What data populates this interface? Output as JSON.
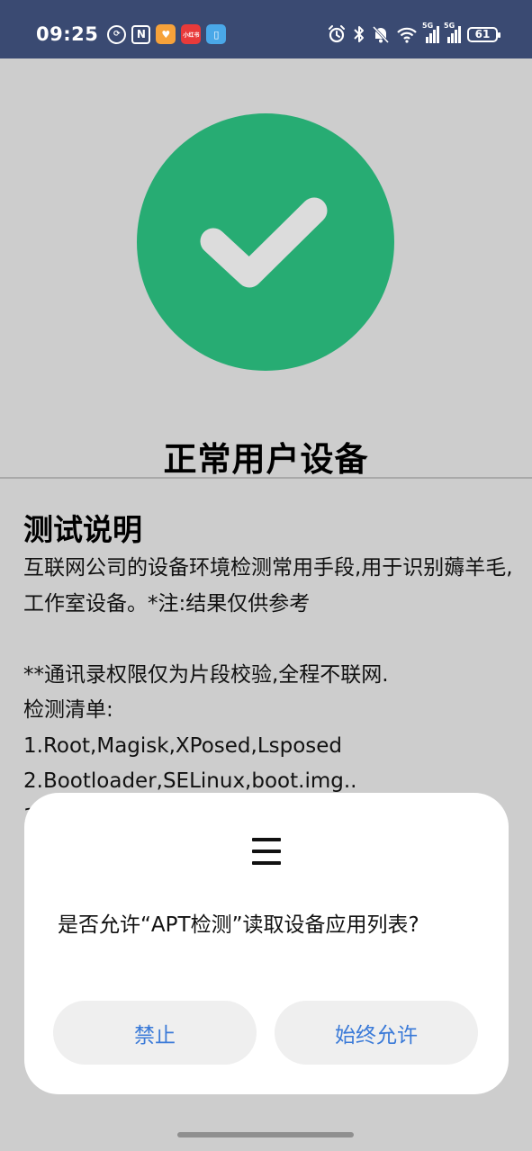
{
  "status_bar": {
    "time": "09:25",
    "left_icons": [
      "data-saver-icon",
      "nfc-icon",
      "app-notification-orange-icon",
      "app-notification-red-icon",
      "app-notification-book-icon"
    ],
    "red_badge_text": "小红书",
    "network_tag_1": "5G",
    "network_tag_2": "5G",
    "battery_level": "61"
  },
  "result": {
    "title": "正常用户设备",
    "status_color": "#27ac73"
  },
  "section": {
    "title": "测试说明",
    "body": "互联网公司的设备环境检测常用手段,用于识别薅羊毛,工作室设备。*注:结果仅供参考\n\n**通讯录权限仅为片段校验,全程不联网.\n检测清单:\n1.Root,Magisk,XPosed,Lsposed\n2.Bootloader,SELinux,boot.img..\n3."
  },
  "dialog": {
    "message": "是否允许“APT检测”读取设备应用列表?",
    "deny_label": "禁止",
    "allow_label": "始终允许",
    "accent_color": "#3a7ad8"
  }
}
